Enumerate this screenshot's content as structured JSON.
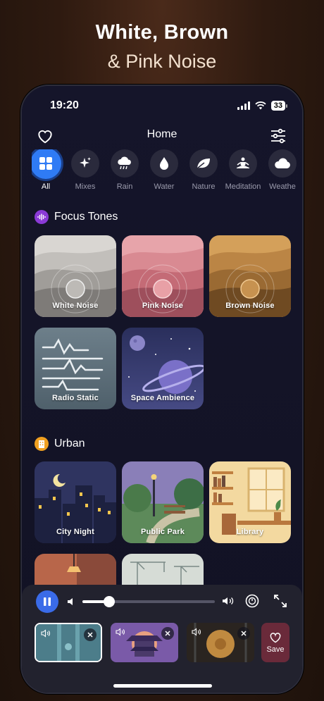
{
  "promo": {
    "line1": "White, Brown",
    "line2": "& Pink Noise"
  },
  "status": {
    "time": "19:20",
    "battery": "33"
  },
  "header": {
    "title": "Home"
  },
  "categories": [
    {
      "label": "All",
      "icon": "grid-icon"
    },
    {
      "label": "Mixes",
      "icon": "sparkles-icon"
    },
    {
      "label": "Rain",
      "icon": "rain-cloud-icon"
    },
    {
      "label": "Water",
      "icon": "water-drop-icon"
    },
    {
      "label": "Nature",
      "icon": "leaf-icon"
    },
    {
      "label": "Meditation",
      "icon": "meditation-icon"
    },
    {
      "label": "Weathe",
      "icon": "cloud-icon"
    }
  ],
  "sections": {
    "focus": {
      "title": "Focus Tones",
      "icon": "waveform-icon",
      "color": "#8a3ad6"
    },
    "urban": {
      "title": "Urban",
      "icon": "building-icon",
      "color": "#f0a020"
    }
  },
  "focus_cards": [
    {
      "label": "White Noise"
    },
    {
      "label": "Pink Noise"
    },
    {
      "label": "Brown Noise"
    },
    {
      "label": "Radio Static"
    },
    {
      "label": "Space Ambience"
    }
  ],
  "urban_cards": [
    {
      "label": "City Night"
    },
    {
      "label": "Public Park"
    },
    {
      "label": "Library"
    }
  ],
  "player": {
    "volume": 0.2,
    "save_label": "Save"
  },
  "colors": {
    "accent": "#2f7bf5",
    "play": "#3a6be8",
    "save": "#6a2a3a"
  }
}
